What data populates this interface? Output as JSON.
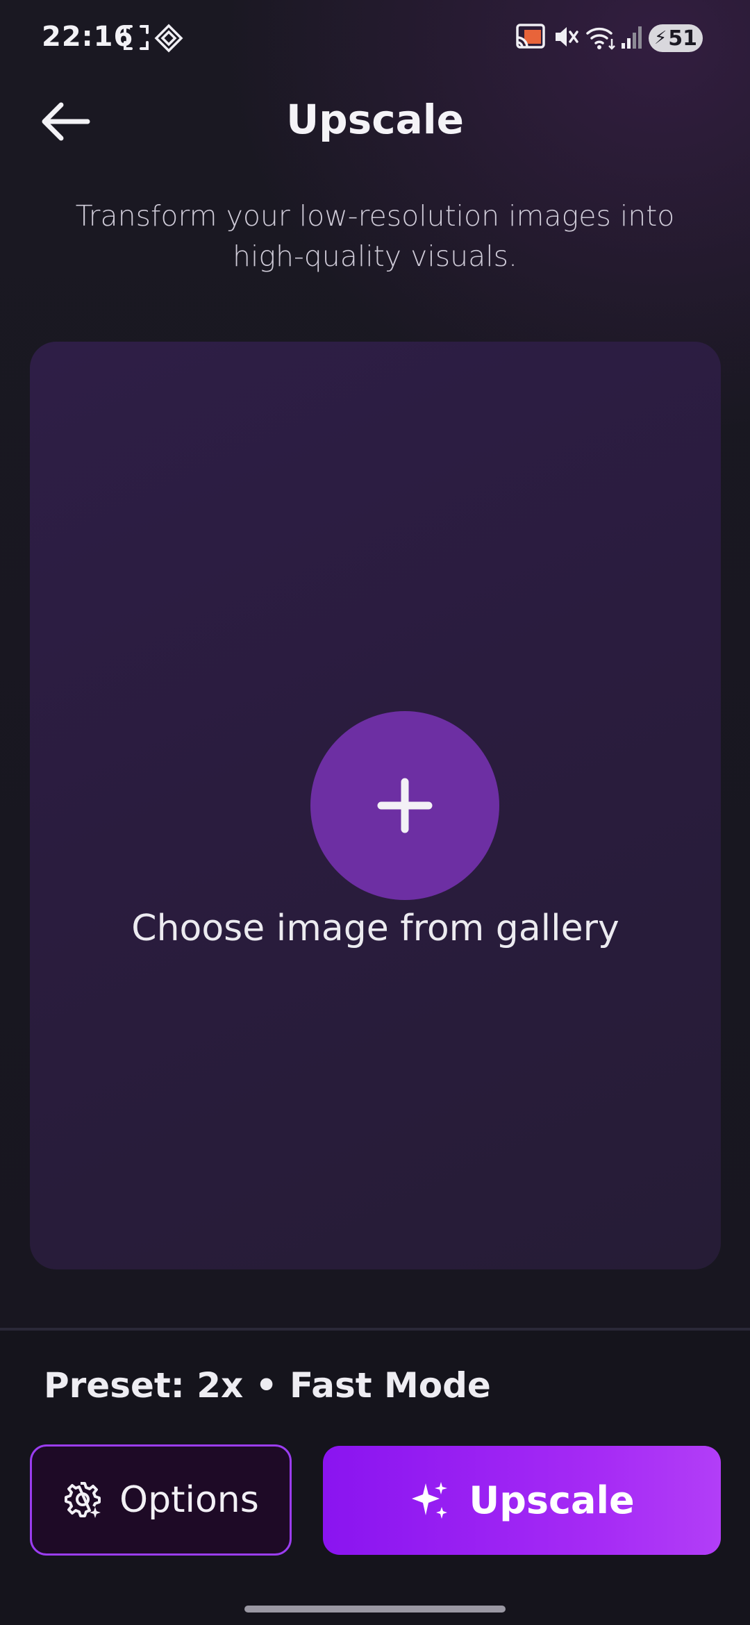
{
  "status_bar": {
    "time": "22:16",
    "battery_level": "51",
    "icons": [
      "screenshot-icon",
      "vpn-icon",
      "cast-icon",
      "mute-icon",
      "wifi-icon",
      "signal-icon",
      "battery-charging-icon"
    ],
    "cast_color": "#e8643a"
  },
  "header": {
    "title": "Upscale",
    "back_icon": "arrow-left-icon"
  },
  "subtitle": "Transform your low-resolution images into high-quality visuals.",
  "picker": {
    "label": "Choose image from gallery",
    "icon": "plus-icon"
  },
  "bottom": {
    "preset": "Preset: 2x • Fast Mode",
    "options_label": "Options",
    "options_icon": "gear-sparkle-icon",
    "upscale_label": "Upscale",
    "upscale_icon": "sparkles-icon"
  },
  "colors": {
    "accent": "#9b3df0",
    "button_gradient_start": "#8a14f0",
    "button_gradient_end": "#b23ef7",
    "background": "#17161f"
  }
}
